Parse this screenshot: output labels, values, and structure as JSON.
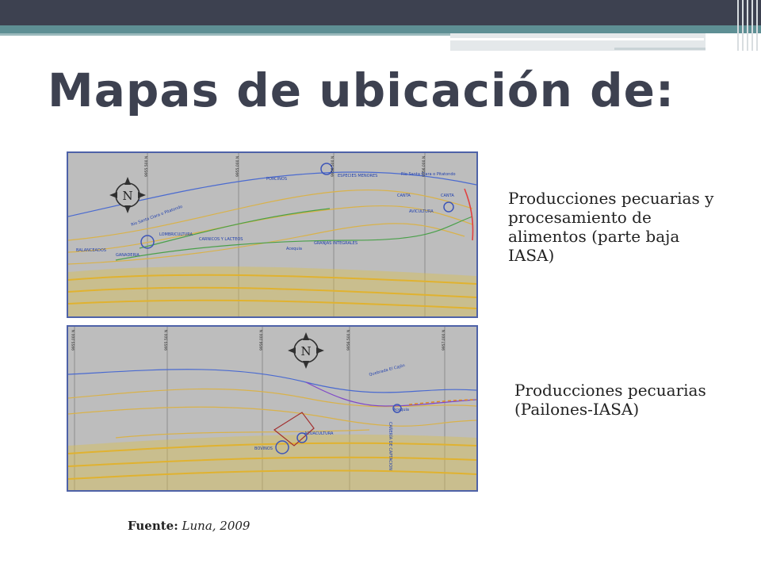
{
  "slide": {
    "title": "Mapas de ubicación de:",
    "maps": [
      {
        "caption": "Producciones pecuarias y procesamiento de alimentos (parte baja IASA)",
        "compass_letter": "N",
        "grid_labels": [
          "9955.500 N",
          "9955.000 N",
          "9956.500 N",
          "9956.000 N"
        ],
        "labels": [
          "Río Santa Clara o Pitatondo",
          "PORCINOS",
          "ESPECIES MENORES",
          "Río Santa Clara o Pitatondo",
          "CANTA",
          "CANTA",
          "AVICULTURA",
          "LOMBRICULTURA",
          "CARNICOS Y LACTEOS",
          "GRANJAS INTEGRALES",
          "Acequia",
          "BALANCEADOS",
          "GANADERIA"
        ]
      },
      {
        "caption": "Producciones pecuarias (Pailones-IASA)",
        "compass_letter": "N",
        "grid_labels": [
          "9955.000 N",
          "9955.500 N",
          "9956.000 N",
          "9956.500 N",
          "9957.000 N"
        ],
        "labels": [
          "Quebrada El Cajón",
          "Acequia",
          "CAÑERÍA DE CAPTACION",
          "ACUACULTURA",
          "BOVINOS"
        ]
      }
    ],
    "source": {
      "label": "Fuente:",
      "value": "Luna, 2009"
    }
  }
}
